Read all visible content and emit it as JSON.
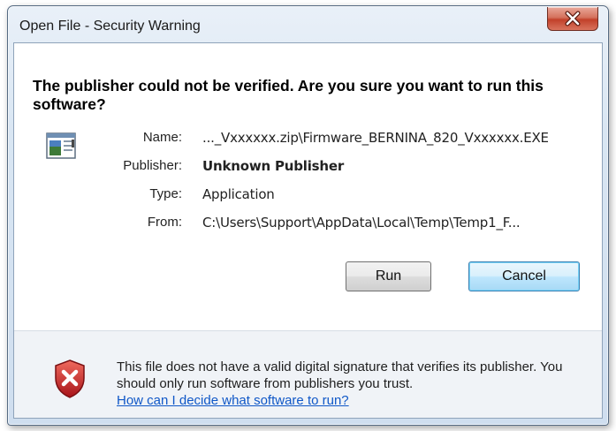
{
  "window": {
    "title": "Open File - Security Warning",
    "close_glyph": "X"
  },
  "dialog": {
    "heading": "The publisher could not be verified.  Are you sure you want to run this software?",
    "details": [
      {
        "label": "Name:",
        "value": "..._Vxxxxxx.zip\\Firmware_BERNINA_820_Vxxxxxx.EXE"
      },
      {
        "label": "Publisher:",
        "value": "Unknown Publisher"
      },
      {
        "label": "Type:",
        "value": "Application"
      },
      {
        "label": "From:",
        "value": "C:\\Users\\Support\\AppData\\Local\\Temp\\Temp1_F..."
      }
    ],
    "buttons": {
      "run": "Run",
      "cancel": "Cancel"
    }
  },
  "footer": {
    "warning_text": "This file does not have a valid digital signature that verifies its publisher.  You should only run software from publishers you trust.",
    "help_link": "How can I decide what software to run?"
  },
  "colors": {
    "frame": "#cfdeef",
    "close_button": "#c2412a",
    "link": "#0f57c7",
    "cancel_focus": "#3c7fb1",
    "shield_red": "#c8282a"
  },
  "icons": {
    "app": "application-window-icon",
    "warning": "red-shield-x-icon",
    "close": "close-icon"
  }
}
